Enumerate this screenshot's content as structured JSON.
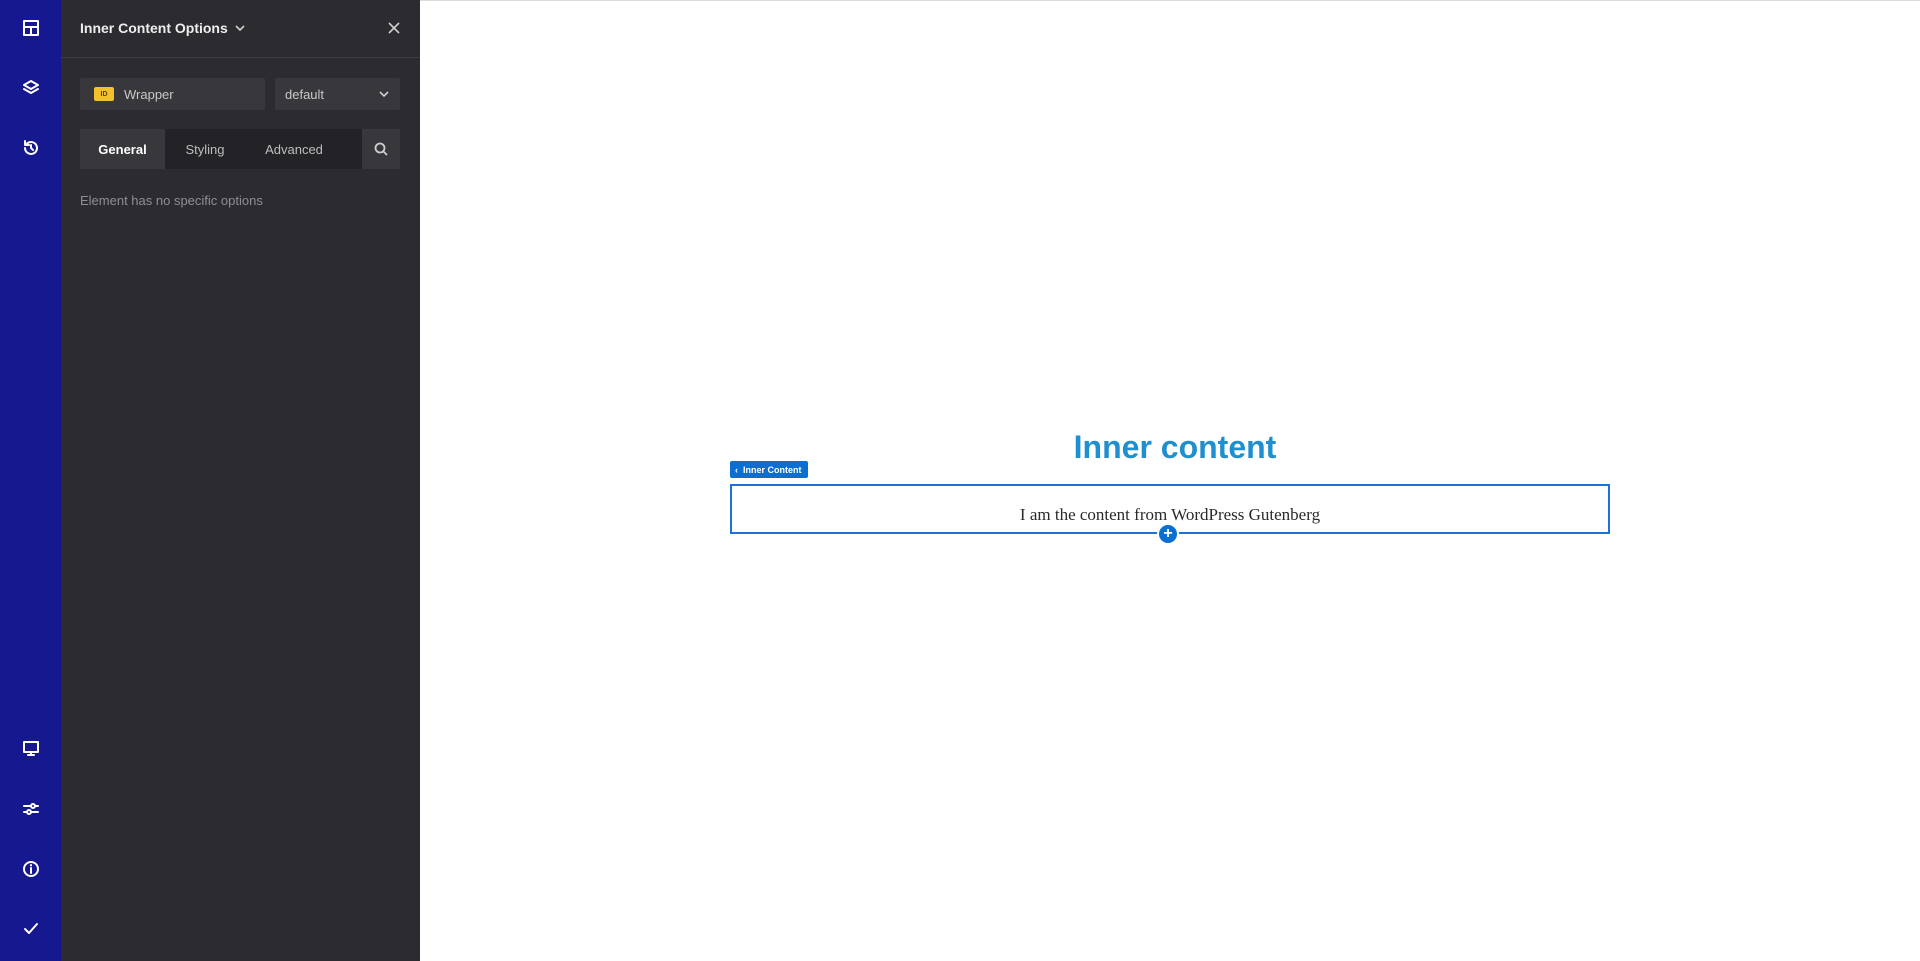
{
  "rail": {
    "top_icons": [
      "layout-icon",
      "layers-icon",
      "history-icon"
    ],
    "bottom_icons": [
      "desktop-icon",
      "settings-sliders-icon",
      "info-icon",
      "check-icon"
    ]
  },
  "panel": {
    "title": "Inner Content Options",
    "id_badge": "ID",
    "id_value": "Wrapper",
    "class_value": "default",
    "tabs": [
      {
        "label": "General",
        "active": true
      },
      {
        "label": "Styling",
        "active": false
      },
      {
        "label": "Advanced",
        "active": false
      }
    ],
    "empty_message": "Element has no specific options"
  },
  "canvas": {
    "heading": "Inner content",
    "element_label": "Inner Content",
    "content_text": "I am the content from WordPress Gutenberg",
    "add_symbol": "+"
  },
  "colors": {
    "rail_bg": "#15188f",
    "panel_bg": "#2c2c30",
    "accent": "#0a6fd1",
    "heading": "#1e8fcf",
    "id_badge": "#f2c12e"
  }
}
